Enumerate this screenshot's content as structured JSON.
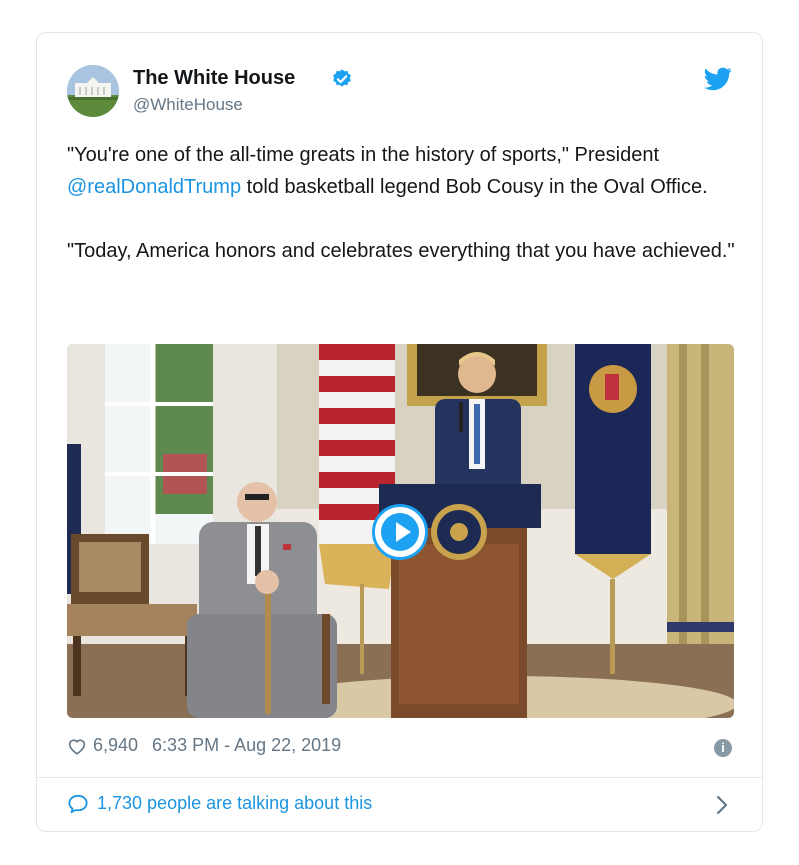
{
  "tweet": {
    "account_name": "The White House",
    "handle": "@WhiteHouse",
    "text": {
      "p1_part1": "\"You're one of the all-time greats in the history of sports,\" President ",
      "mention": "@realDonaldTrump",
      "p1_part2": " told basketball legend Bob Cousy in the Oval Office.",
      "p2": "\"Today, America honors and celebrates everything that you have achieved.\""
    },
    "likes": "6,940",
    "timestamp": "6:33 PM - Aug 22, 2019",
    "conversation": "1,730 people are talking about this"
  },
  "icons": {
    "verified": "verified-badge-icon",
    "platform": "twitter-bird-icon",
    "like": "heart-icon",
    "info": "info-icon",
    "reply": "speech-bubble-icon",
    "more": "chevron-right-icon",
    "play": "play-icon"
  },
  "colors": {
    "accent": "#1da1f2",
    "link": "#1b95e0",
    "muted": "#657786",
    "border": "#e1e8ed"
  }
}
